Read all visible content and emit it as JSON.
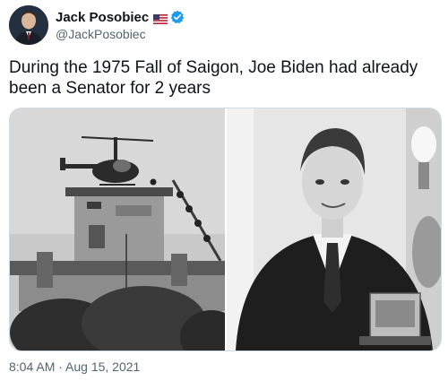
{
  "author": {
    "name": "Jack Posobiec",
    "handle": "@JackPosobiec",
    "badges": [
      "us-flag-icon",
      "verified-badge-icon"
    ],
    "verified_color": "#1d9bf0"
  },
  "tweet": {
    "text": "During the 1975 Fall of Saigon, Joe Biden had already been a Senator for 2 years",
    "timestamp": "8:04 AM · Aug 15, 2021"
  },
  "media": {
    "count": 2,
    "style": "black-and-white photographs"
  },
  "colors": {
    "text": "#0f1419",
    "secondary": "#536471",
    "border": "#cfd9de"
  }
}
